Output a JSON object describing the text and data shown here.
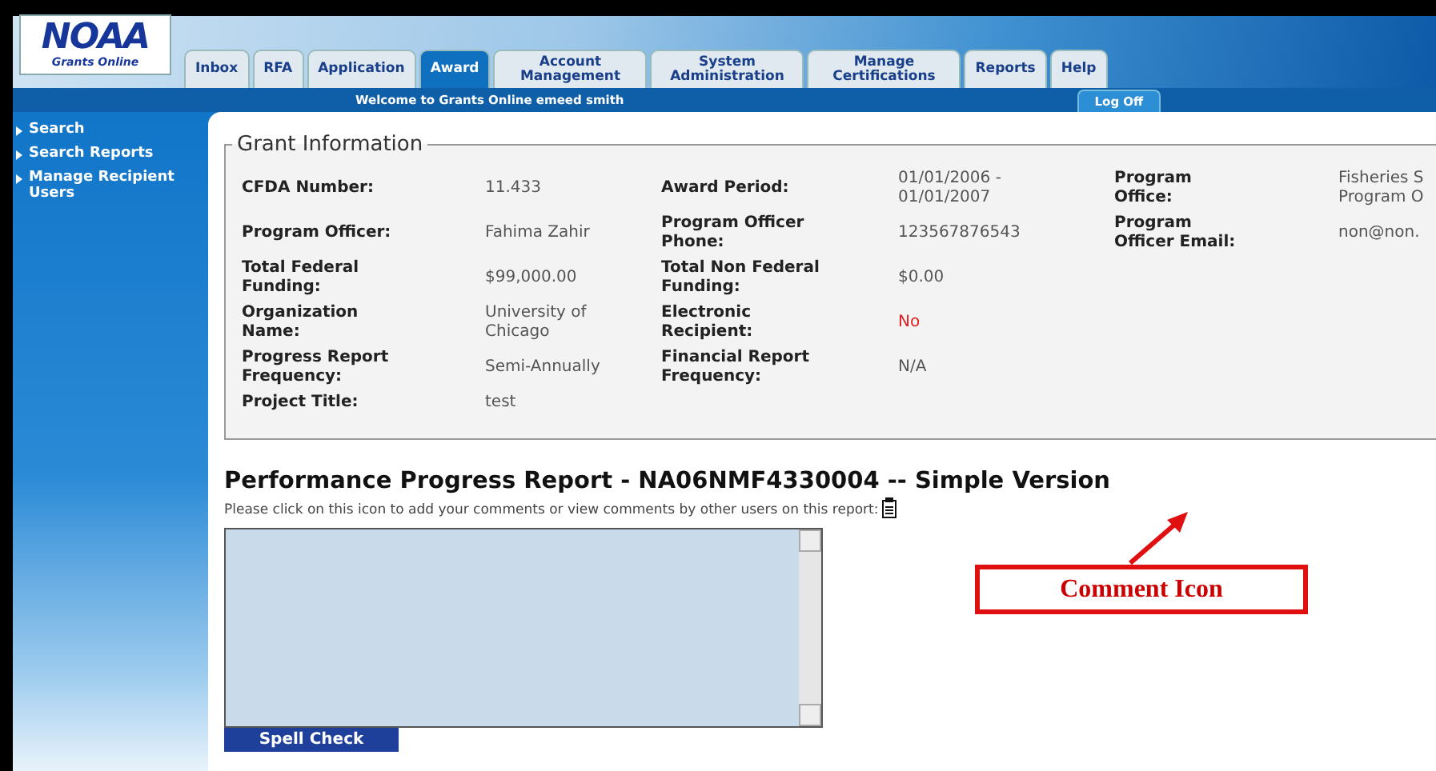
{
  "header": {
    "logo": {
      "title": "NOAA",
      "subtitle": "Grants Online"
    },
    "tabs": [
      {
        "label": "Inbox",
        "selected": false
      },
      {
        "label": "RFA",
        "selected": false
      },
      {
        "label": "Application",
        "selected": false
      },
      {
        "label": "Award",
        "selected": true
      },
      {
        "label": "Account Management",
        "selected": false
      },
      {
        "label": "System Administration",
        "selected": false
      },
      {
        "label": "Manage Certifications",
        "selected": false
      },
      {
        "label": "Reports",
        "selected": false
      },
      {
        "label": "Help",
        "selected": false
      }
    ],
    "welcome": "Welcome to Grants Online emeed smith",
    "log_off": "Log Off"
  },
  "sidebar": {
    "items": [
      "Search",
      "Search Reports",
      "Manage Recipient Users"
    ]
  },
  "grant_info": {
    "title": "Grant Information",
    "rows": [
      [
        {
          "label": "CFDA Number:",
          "value": "11.433",
          "alert": false
        },
        {
          "label": "Award Period:",
          "value": "01/01/2006 - 01/01/2007",
          "alert": false
        },
        {
          "label": "Program Office:",
          "value": "Fisheries S Program O",
          "alert": false
        }
      ],
      [
        {
          "label": "Program Officer:",
          "value": "Fahima Zahir",
          "alert": false
        },
        {
          "label": "Program Officer Phone:",
          "value": "123567876543",
          "alert": false
        },
        {
          "label": "Program Officer Email:",
          "value": "non@non.",
          "alert": false
        }
      ],
      [
        {
          "label": "Total Federal Funding:",
          "value": "$99,000.00",
          "alert": false
        },
        {
          "label": "Total Non Federal Funding:",
          "value": "$0.00",
          "alert": false
        }
      ],
      [
        {
          "label": "Organization Name:",
          "value": "University of Chicago",
          "alert": false
        },
        {
          "label": "Electronic Recipient:",
          "value": "No",
          "alert": true
        }
      ],
      [
        {
          "label": "Progress Report Frequency:",
          "value": "Semi-Annually",
          "alert": false
        },
        {
          "label": "Financial Report Frequency:",
          "value": "N/A",
          "alert": false
        }
      ],
      [
        {
          "label": "Project Title:",
          "value": "test",
          "alert": false
        }
      ]
    ]
  },
  "report": {
    "title": "Performance Progress Report - NA06NMF4330004 -- Simple Version",
    "instruction": "Please click on this icon to add your comments or view comments by other users on this report:",
    "spell_check": "Spell Check",
    "callout": "Comment Icon"
  }
}
